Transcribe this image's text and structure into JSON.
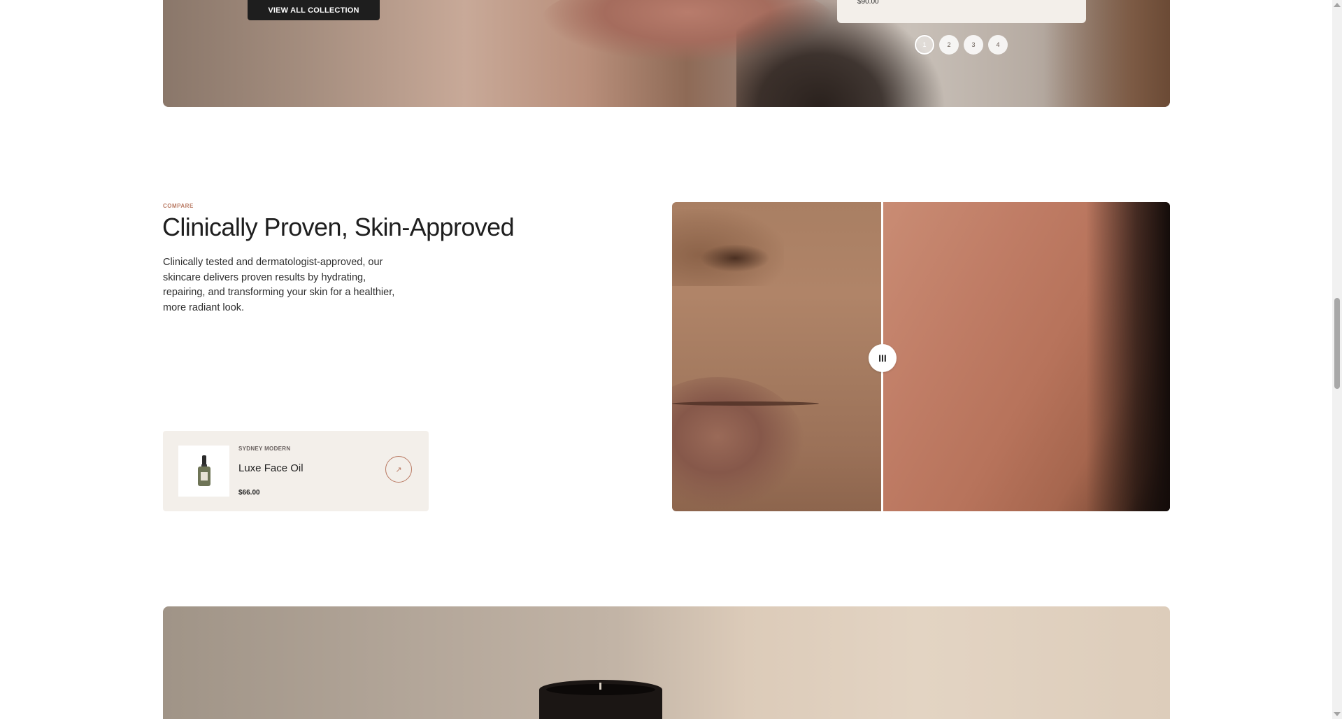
{
  "hero_top": {
    "view_all_label": "VIEW ALL COLLECTION",
    "price_card_price": "$90.00",
    "slider_dots": [
      "1",
      "2",
      "3",
      "4"
    ],
    "active_dot": "1"
  },
  "compare": {
    "eyebrow": "COMPARE",
    "title": "Clinically Proven, Skin-Approved",
    "description": "Clinically tested and dermatologist-approved, our skincare delivers proven results by hydrating, repairing, and transforming your skin for a healthier, more radiant look.",
    "handle_label": "III",
    "slider_position_percent": 42
  },
  "product": {
    "vendor": "SYDNEY MODERN",
    "name": "Luxe Face Oil",
    "price": "$66.00",
    "link_icon": "arrow-up-right-icon"
  },
  "colors": {
    "accent": "#b97a63",
    "dark_button": "#1e1e1e",
    "card_bg": "#f3efea"
  }
}
